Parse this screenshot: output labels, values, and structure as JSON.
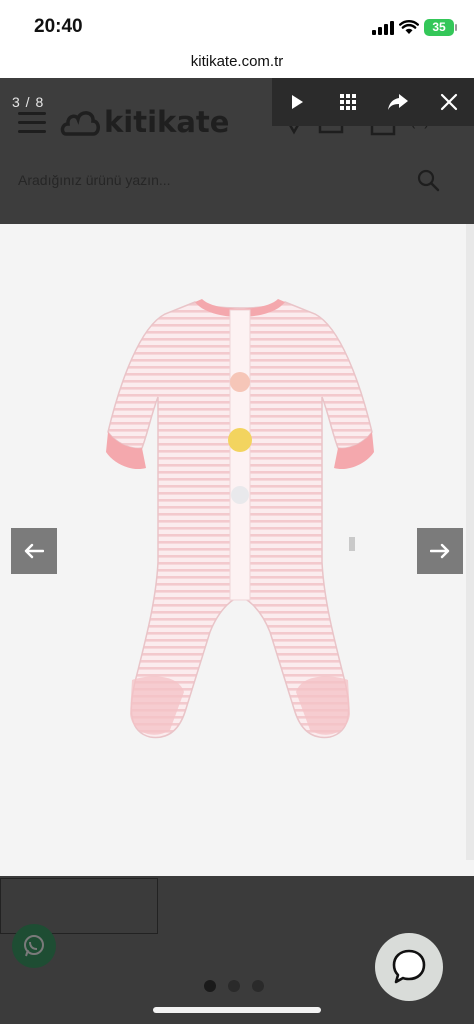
{
  "status_bar": {
    "time": "20:40",
    "battery": "35"
  },
  "browser": {
    "url": "kitikate.com.tr"
  },
  "site_header": {
    "logo_text": "kitikate",
    "cart_count": "(0)",
    "search_placeholder": "Aradığınız ürünü yazın..."
  },
  "lightbox": {
    "counter": "3 / 8",
    "toolbar": [
      "play-icon",
      "grid-icon",
      "share-icon",
      "close-icon"
    ],
    "current_slide": 3,
    "total_slides": 8
  },
  "pagination": {
    "dot_count": 3,
    "active_index": 0
  },
  "colors": {
    "overlay": "#3d3d3d",
    "toolbar": "#2b2b2b",
    "arrow": "#7b7b7b",
    "onesie": "#f7d9dc",
    "trim": "#f4a8ad"
  }
}
